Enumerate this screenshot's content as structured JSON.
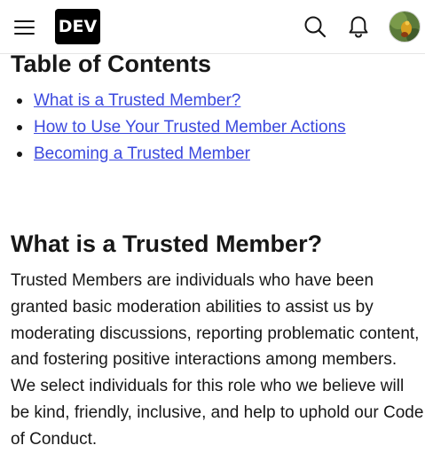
{
  "header": {
    "logo_text": "DEV",
    "icons": [
      "hamburger-menu-icon",
      "search-icon",
      "bell-icon",
      "avatar"
    ]
  },
  "toc": {
    "title": "Table of Contents",
    "items": [
      {
        "label": "What is a Trusted Member?"
      },
      {
        "label": "How to Use Your Trusted Member Actions"
      },
      {
        "label": "Becoming a Trusted Member"
      }
    ]
  },
  "section": {
    "title": "What is a Trusted Member?",
    "paragraph": "Trusted Members are individuals who have been granted basic moderation abilities to assist us by moderating discussions, reporting problematic content, and fostering positive interactions among members. We select individuals for this role who we believe will be kind, friendly, inclusive, and help to uphold our Code of Conduct."
  },
  "colors": {
    "link": "#3b49df",
    "text": "#171717",
    "logo_bg": "#000000"
  }
}
